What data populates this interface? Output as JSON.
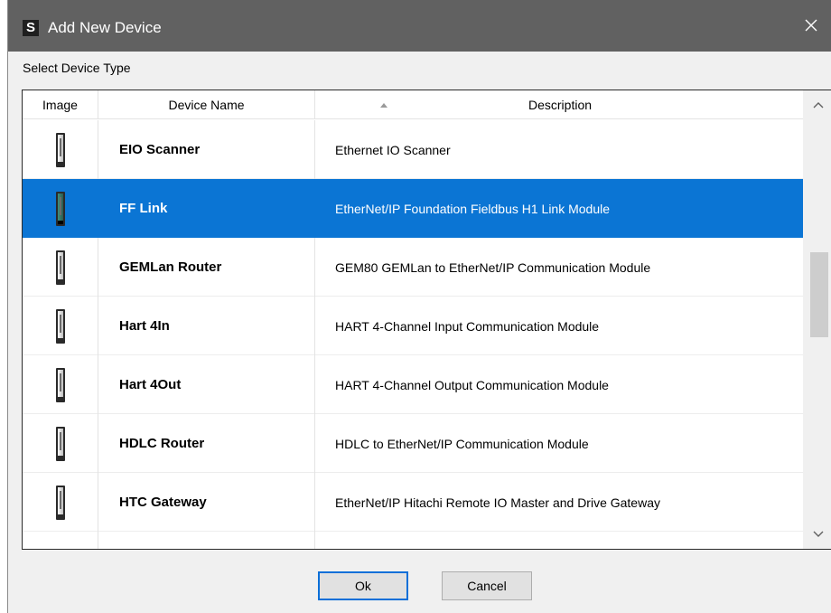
{
  "window": {
    "title": "Add New Device",
    "app_icon_letter": "S"
  },
  "section_label": "Select Device Type",
  "table": {
    "columns": [
      "Image",
      "Device Name",
      "Description"
    ],
    "sorted_column": "Device Name",
    "sort_direction": "ascending",
    "selected_row": 1,
    "rows": [
      {
        "name": "EIO Scanner",
        "description": "Ethernet IO Scanner",
        "icon": "device-module-icon"
      },
      {
        "name": "FF Link",
        "description": "EtherNet/IP Foundation Fieldbus H1 Link Module",
        "icon": "device-module-icon"
      },
      {
        "name": "GEMLan Router",
        "description": "GEM80 GEMLan to EtherNet/IP Communication Module",
        "icon": "device-module-icon"
      },
      {
        "name": "Hart 4In",
        "description": "HART 4-Channel Input Communication Module",
        "icon": "device-module-icon"
      },
      {
        "name": "Hart 4Out",
        "description": "HART 4-Channel Output Communication Module",
        "icon": "device-module-icon"
      },
      {
        "name": "HDLC Router",
        "description": "HDLC to EtherNet/IP Communication Module",
        "icon": "device-module-icon"
      },
      {
        "name": "HTC Gateway",
        "description": "EtherNet/IP Hitachi Remote IO Master and Drive Gateway",
        "icon": "device-module-icon"
      }
    ]
  },
  "buttons": {
    "ok_label": "Ok",
    "cancel_label": "Cancel"
  },
  "colors": {
    "title_bar": "#616161",
    "selection": "#0b75d4",
    "ok_border": "#0a6fd8"
  }
}
